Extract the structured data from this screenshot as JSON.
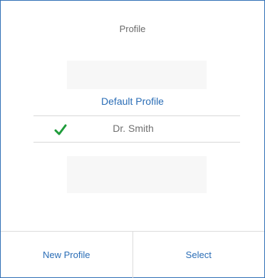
{
  "dialog": {
    "title": "Profile",
    "options": [
      {
        "label": "Default Profile",
        "selected": false
      },
      {
        "label": "Dr. Smith",
        "selected": true
      }
    ],
    "footer": {
      "new_profile_label": "New Profile",
      "select_label": "Select"
    },
    "colors": {
      "accent": "#2a6db6",
      "check": "#1f9c3b",
      "border": "#2f6fb5"
    }
  }
}
